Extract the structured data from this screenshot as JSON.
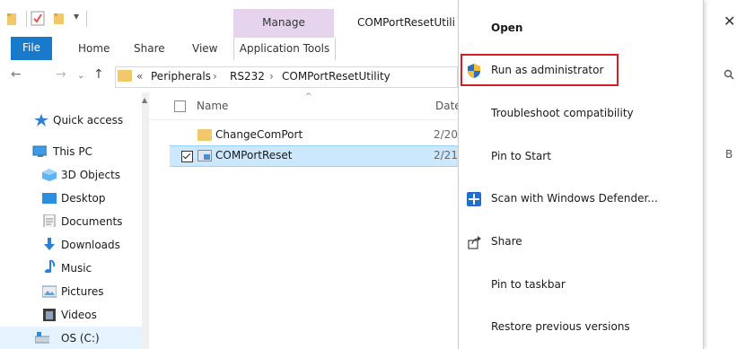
{
  "window": {
    "title": "COMPortResetUtili",
    "manage_tab": "Manage",
    "close_glyph": "✕"
  },
  "ribbon": {
    "tabs": [
      "File",
      "Home",
      "Share",
      "View",
      "Application Tools"
    ]
  },
  "address": {
    "prefix": "«",
    "crumbs": [
      "Peripherals",
      "RS232",
      "COMPortResetUtility"
    ],
    "separator": "›"
  },
  "nav": {
    "items": [
      {
        "label": "Quick access",
        "icon": "star-icon"
      },
      {
        "label": "This PC",
        "icon": "monitor-icon"
      },
      {
        "label": "3D Objects",
        "icon": "cube-icon"
      },
      {
        "label": "Desktop",
        "icon": "desktop-icon"
      },
      {
        "label": "Documents",
        "icon": "document-icon"
      },
      {
        "label": "Downloads",
        "icon": "download-icon"
      },
      {
        "label": "Music",
        "icon": "music-note-icon"
      },
      {
        "label": "Pictures",
        "icon": "picture-icon"
      },
      {
        "label": "Videos",
        "icon": "film-icon"
      },
      {
        "label": "OS (C:)",
        "icon": "drive-icon"
      }
    ]
  },
  "list": {
    "columns": {
      "name": "Name",
      "date": "Date"
    },
    "rows": [
      {
        "name": "ChangeComPort",
        "date": "2/20",
        "type": "folder"
      },
      {
        "name": "COMPortReset",
        "date": "2/21",
        "type": "application",
        "selected": true
      }
    ]
  },
  "partial_right": {
    "size_fragment": "B"
  },
  "context_menu": {
    "items": [
      {
        "label": "Open",
        "icon": null
      },
      {
        "label": "Run as administrator",
        "icon": "uac-shield-icon",
        "highlighted": true
      },
      {
        "label": "Troubleshoot compatibility",
        "icon": null
      },
      {
        "label": "Pin to Start",
        "icon": null
      },
      {
        "label": "Scan with Windows Defender...",
        "icon": "defender-icon"
      },
      {
        "label": "Share",
        "icon": "share-icon"
      },
      {
        "label": "Pin to taskbar",
        "icon": null
      },
      {
        "label": "Restore previous versions",
        "icon": null
      }
    ]
  },
  "colors": {
    "file_tab": "#1979ca",
    "manage_tab": "#e6d4ee",
    "selection": "#cce8ff",
    "highlight_box": "#d01f25",
    "folder": "#f3c86a"
  }
}
